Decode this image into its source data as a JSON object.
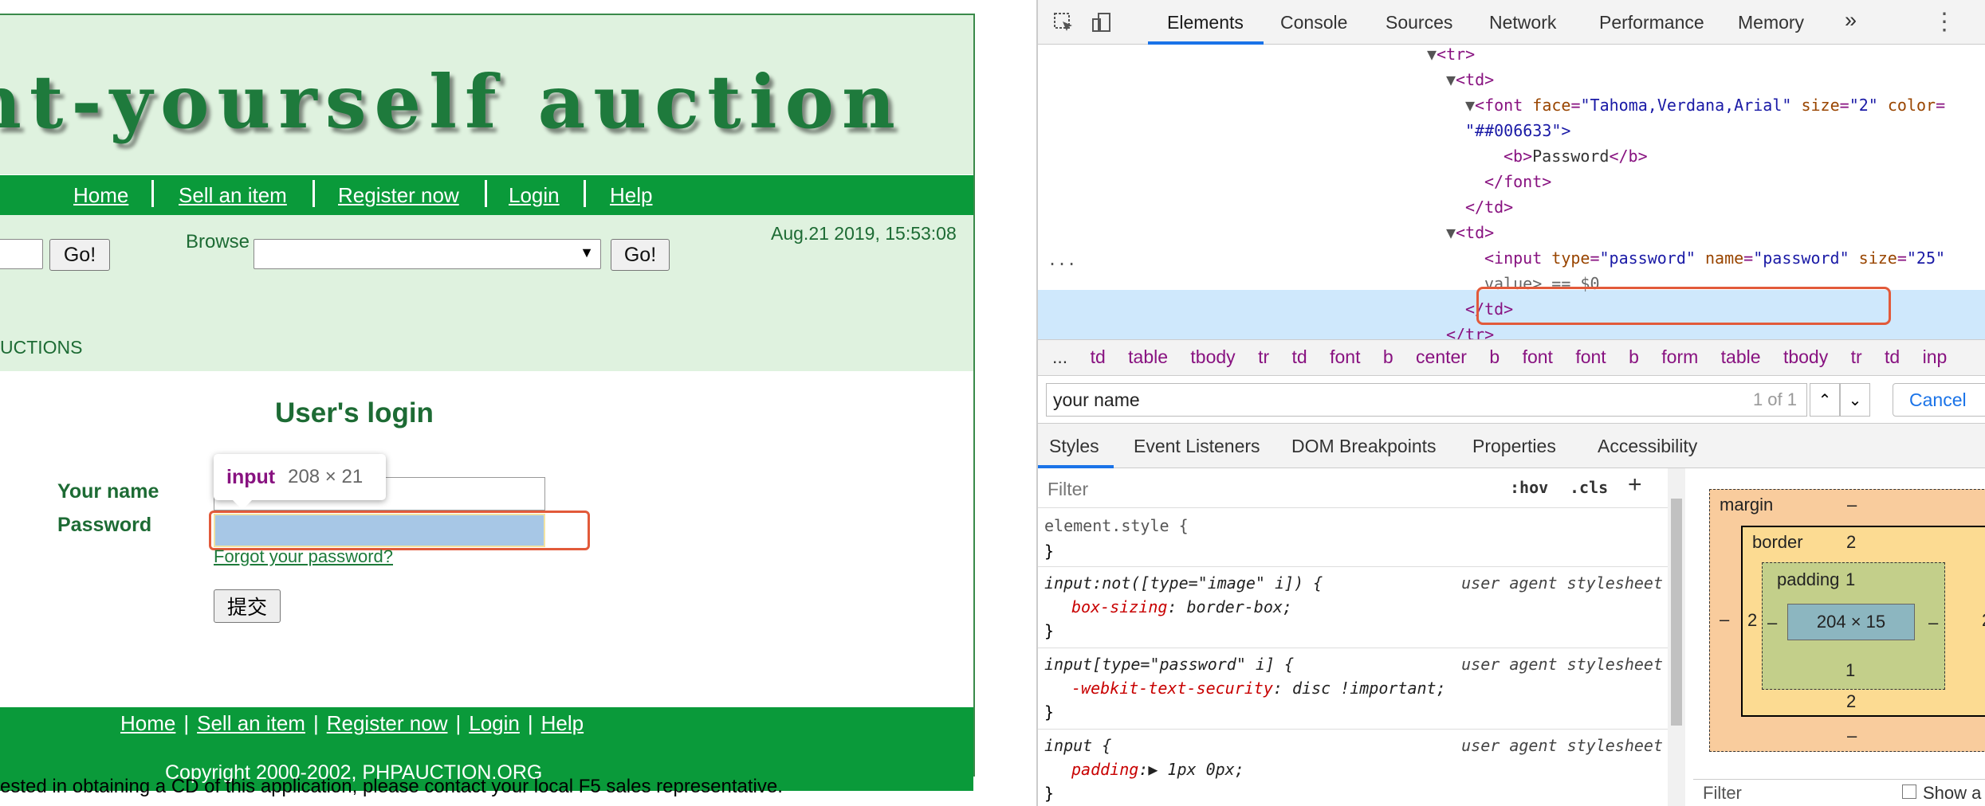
{
  "site": {
    "banner_title": "nt-yourself auction",
    "nav": [
      "Home",
      "Sell an item",
      "Register now",
      "Login",
      "Help"
    ],
    "go_label": "Go!",
    "browse_label": "Browse",
    "datetime": "Aug.21 2019, 15:53:08",
    "auctions_label": "UCTIONS",
    "login_title": "User's login",
    "name_label": "Your name",
    "password_label": "Password",
    "forgot_label": "Forgot your password?",
    "submit_label": "提交",
    "tooltip_tag": "input",
    "tooltip_dims": "208 × 21",
    "footer_links": [
      "Home",
      "Sell an item",
      "Register now",
      "Login",
      "Help"
    ],
    "footer_sep": "|",
    "copyright": "Copyright 2000-2002, PHPAUCTION.ORG",
    "cd_note": "rested in obtaining a CD of this application, please contact your local F5 sales representative."
  },
  "devtools": {
    "tabs": [
      "Elements",
      "Console",
      "Sources",
      "Network",
      "Performance",
      "Memory",
      "»"
    ],
    "dom": {
      "tr_open": "<tr>",
      "td_open": "<td>",
      "font_open_a": "<font ",
      "attr_face": "face",
      "val_face": "\"Tahoma,Verdana,Arial\"",
      "attr_size": "size",
      "val_size": "\"2\"",
      "attr_color": "color",
      "val_color_cont": "\"##006633\">",
      "b_text": "Password",
      "b_open": "<b>",
      "b_close": "</b>",
      "font_close": "</font>",
      "td_close": "</td>",
      "input_open": "<input ",
      "attr_type": "type",
      "val_type": "\"password\"",
      "attr_name": "name",
      "val_name": "\"password\"",
      "attr_size2": "size",
      "val_size2": "\"25\"",
      "value_tail": "value> == $0",
      "tr_close": "</tr>",
      "dots": "..."
    },
    "crumbs": [
      "...",
      "td",
      "table",
      "tbody",
      "tr",
      "td",
      "font",
      "b",
      "center",
      "b",
      "font",
      "font",
      "b",
      "form",
      "table",
      "tbody",
      "tr",
      "td",
      "inp"
    ],
    "find_value": "your name",
    "find_count": "1 of 1",
    "cancel_label": "Cancel",
    "panel_tabs": [
      "Styles",
      "Event Listeners",
      "DOM Breakpoints",
      "Properties",
      "Accessibility"
    ],
    "filter_placeholder": "Filter",
    "hov": ":hov",
    "cls": ".cls",
    "plus": "+",
    "rules": {
      "r1_sel": "element.style {",
      "close": "}",
      "r2_sel": "input:not([type=\"image\" i]) {",
      "r2_prop": "box-sizing",
      "r2_val": ": border-box;",
      "r3_sel": "input[type=\"password\" i] {",
      "r3_prop": "-webkit-text-security",
      "r3_val": ": disc !important;",
      "r4_sel": "input {",
      "r4_prop": "padding",
      "r4_val": ":▶ 1px 0px;",
      "ua": "user agent stylesheet"
    },
    "box": {
      "margin_label": "margin",
      "margin_top": "–",
      "margin_bottom": "–",
      "margin_left": "–",
      "border_label": "border",
      "border_top": "2",
      "border_bottom": "2",
      "border_left": "2",
      "border_right": "2",
      "padding_label": "padding",
      "padding_top": "1",
      "padding_bottom": "1",
      "padding_left": "–",
      "padding_right": "–",
      "content": "204 × 15"
    },
    "box_filter": "Filter",
    "show_all": "Show a"
  }
}
